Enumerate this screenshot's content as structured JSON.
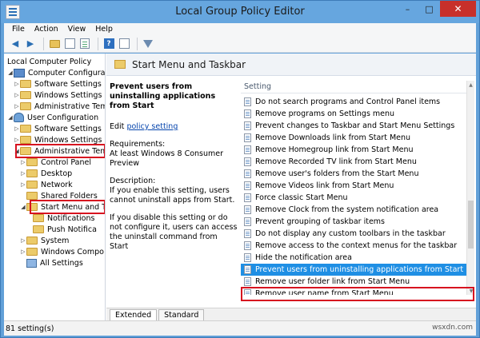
{
  "window": {
    "title": "Local Group Policy Editor"
  },
  "menu": [
    "File",
    "Action",
    "View",
    "Help"
  ],
  "toolbar_icons": [
    "back-icon",
    "forward-icon",
    "folder-up-icon",
    "show-hide-tree-icon",
    "export-list-icon",
    "help-icon",
    "properties-icon",
    "filter-icon"
  ],
  "tree": [
    {
      "label": "Local Computer Policy",
      "icon": "settings-icon"
    },
    {
      "label": "Computer Configuration",
      "icon": "computer-icon"
    },
    {
      "label": "Software Settings",
      "icon": "folder-icon"
    },
    {
      "label": "Windows Settings",
      "icon": "folder-icon"
    },
    {
      "label": "Administrative Temp",
      "icon": "folder-icon"
    },
    {
      "label": "User Configuration",
      "icon": "user-icon"
    },
    {
      "label": "Software Settings",
      "icon": "folder-icon"
    },
    {
      "label": "Windows Settings",
      "icon": "folder-icon"
    },
    {
      "label": "Administrative Temp",
      "icon": "folder-icon"
    },
    {
      "label": "Control Panel",
      "icon": "folder-icon"
    },
    {
      "label": "Desktop",
      "icon": "folder-icon"
    },
    {
      "label": "Network",
      "icon": "folder-icon"
    },
    {
      "label": "Shared Folders",
      "icon": "folder-icon"
    },
    {
      "label": "Start Menu and T",
      "icon": "folder-icon"
    },
    {
      "label": "Notifications",
      "icon": "folder-icon"
    },
    {
      "label": "Push Notifica",
      "icon": "folder-icon"
    },
    {
      "label": "System",
      "icon": "folder-icon"
    },
    {
      "label": "Windows Compo",
      "icon": "folder-icon"
    },
    {
      "label": "All Settings",
      "icon": "folder-icon"
    }
  ],
  "right_header": "Start Menu and Taskbar",
  "description": {
    "title": "Prevent users from uninstalling applications from Start",
    "edit_prefix": "Edit",
    "edit_link": "policy setting",
    "requirements_label": "Requirements:",
    "requirements_value": "At least Windows 8 Consumer Preview",
    "description_label": "Description:",
    "enabled_text": "If you enable this setting, users cannot uninstall apps from Start.",
    "disabled_text": "If you disable this setting or do not configure it, users can access the uninstall command from Start"
  },
  "settings_header": "Setting",
  "settings": [
    "Do not search programs and Control Panel items",
    "Remove programs on Settings menu",
    "Prevent changes to Taskbar and Start Menu Settings",
    "Remove Downloads link from Start Menu",
    "Remove Homegroup link from Start Menu",
    "Remove Recorded TV link from Start Menu",
    "Remove user's folders from the Start Menu",
    "Remove Videos link from Start Menu",
    "Force classic Start Menu",
    "Remove Clock from the system notification area",
    "Prevent grouping of taskbar items",
    "Do not display any custom toolbars in the taskbar",
    "Remove access to the context menus for the taskbar",
    "Hide the notification area",
    "Prevent users from uninstalling applications from Start",
    "Remove user folder link from Start Menu",
    "Remove user name from Start Menu"
  ],
  "selected_setting": "Prevent users from uninstalling applications from Start",
  "tabs": [
    "Extended",
    "Standard"
  ],
  "status": "81 setting(s)",
  "watermark": "wsxdn.com",
  "colors": {
    "titlebar": "#66a6df",
    "selection": "#1f8fe4",
    "highlight_box": "#d7111f"
  }
}
